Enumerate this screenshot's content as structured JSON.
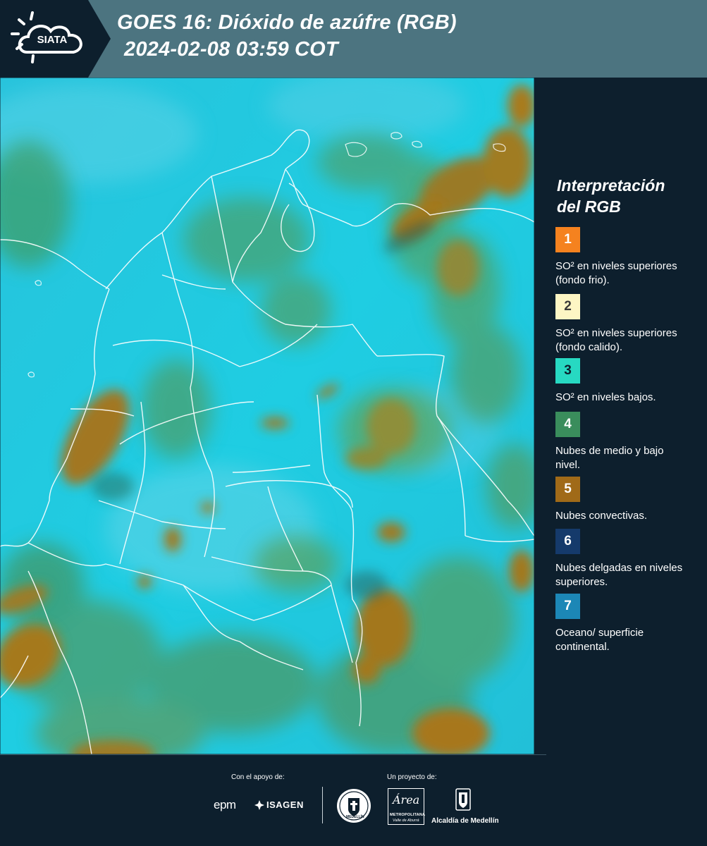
{
  "header": {
    "logo_text": "SIATA",
    "title": "GOES 16: Dióxido de azúfre (RGB)",
    "subtitle": "2024-02-08 03:59 COT",
    "background_color": "#4c7480",
    "logo_background_color": "#0d1f2d"
  },
  "map": {
    "image_kind": "satellite SO2 RGB composite over Colombia and Venezuela",
    "colors": {
      "background_surface": "#1fc8df",
      "mid_low_clouds": "#3f9a5c",
      "convective_clouds": "#a97a1e",
      "borders": "#ffffff"
    }
  },
  "legend": {
    "title_line1": "Interpretación",
    "title_line2": "del RGB",
    "items": [
      {
        "number": "1",
        "color": "#f5821f",
        "text_color": "#ffffff",
        "label": "SO² en niveles superiores (fondo frio)."
      },
      {
        "number": "2",
        "color": "#fdf6c4",
        "text_color": "#3a3a3a",
        "label": "SO² en niveles superiores (fondo calido)."
      },
      {
        "number": "3",
        "color": "#27d9c2",
        "text_color": "#0d1f2d",
        "label": "SO² en niveles bajos."
      },
      {
        "number": "4",
        "color": "#3a8d5c",
        "text_color": "#ffffff",
        "label": "Nubes de medio y bajo nivel."
      },
      {
        "number": "5",
        "color": "#a06a18",
        "text_color": "#ffffff",
        "label": "Nubes convectivas."
      },
      {
        "number": "6",
        "color": "#153a6b",
        "text_color": "#ffffff",
        "label": "Nubes delgadas en niveles superiores."
      },
      {
        "number": "7",
        "color": "#1c87b6",
        "text_color": "#ffffff",
        "label": "Oceano/ superficie continental."
      }
    ]
  },
  "footer": {
    "support_caption": "Con el apoyo de:",
    "project_caption": "Un proyecto de:",
    "support_logos": [
      "epm",
      "ISAGEN"
    ],
    "area_logo_text": "Área",
    "area_subtext_1": "METROPOLITANA",
    "area_subtext_2": "Valle de Aburrá",
    "alcaldia_text": "Alcaldía de Medellín",
    "seal_text": "MEDELLÍN"
  }
}
